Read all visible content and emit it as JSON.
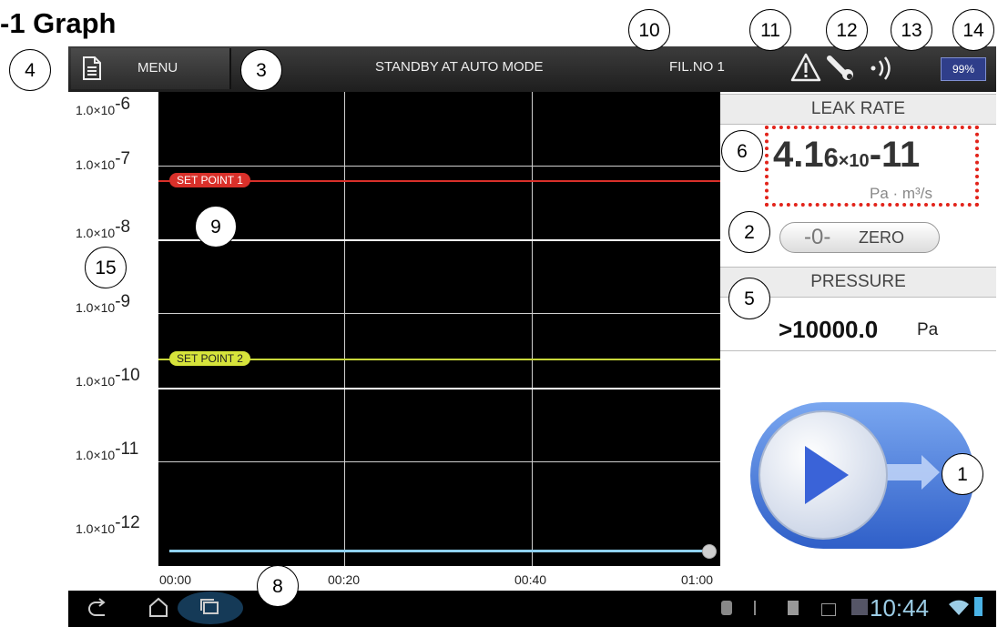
{
  "document": {
    "heading": "-1 Graph"
  },
  "topbar": {
    "menu_label": "MENU",
    "status": "STANDBY AT AUTO MODE",
    "file": "FIL.NO 1",
    "battery": "99%"
  },
  "graph": {
    "y_ticks": [
      {
        "base": "1.0×10",
        "exp": "-6"
      },
      {
        "base": "1.0×10",
        "exp": "-7"
      },
      {
        "base": "1.0×10",
        "exp": "-8"
      },
      {
        "base": "1.0×10",
        "exp": "-9"
      },
      {
        "base": "1.0×10",
        "exp": "-10"
      },
      {
        "base": "1.0×10",
        "exp": "-11"
      },
      {
        "base": "1.0×10",
        "exp": "-12"
      }
    ],
    "x_ticks": [
      "00:00",
      "00:20",
      "00:40",
      "01:00"
    ],
    "set_point_1": "SET POINT 1",
    "set_point_2": "SET POINT 2",
    "colors": {
      "set_point_1": "#d9302a",
      "set_point_2": "#d6e33b",
      "slider": "#8fd1ef"
    }
  },
  "leak_rate": {
    "header": "LEAK RATE",
    "mantissa": "4.1",
    "small_digit": "6",
    "times": "×10",
    "exponent": "-11",
    "unit": "Pa · m³/s"
  },
  "zero_button": {
    "symbol": "-0-",
    "label": "ZERO"
  },
  "pressure": {
    "header": "PRESSURE",
    "value": ">10000.0",
    "unit": "Pa"
  },
  "navbar": {
    "clock": "10:44"
  },
  "callouts": {
    "c1": "1",
    "c2": "2",
    "c3": "3",
    "c4": "4",
    "c5": "5",
    "c6": "6",
    "c8": "8",
    "c9": "9",
    "c10": "10",
    "c11": "11",
    "c12": "12",
    "c13": "13",
    "c14": "14",
    "c15": "15"
  },
  "icons": [
    "document-icon",
    "warning-icon",
    "wrench-icon",
    "signal-icon",
    "battery-icon",
    "play-icon",
    "back-icon",
    "home-icon",
    "recent-apps-icon",
    "wifi-icon"
  ]
}
